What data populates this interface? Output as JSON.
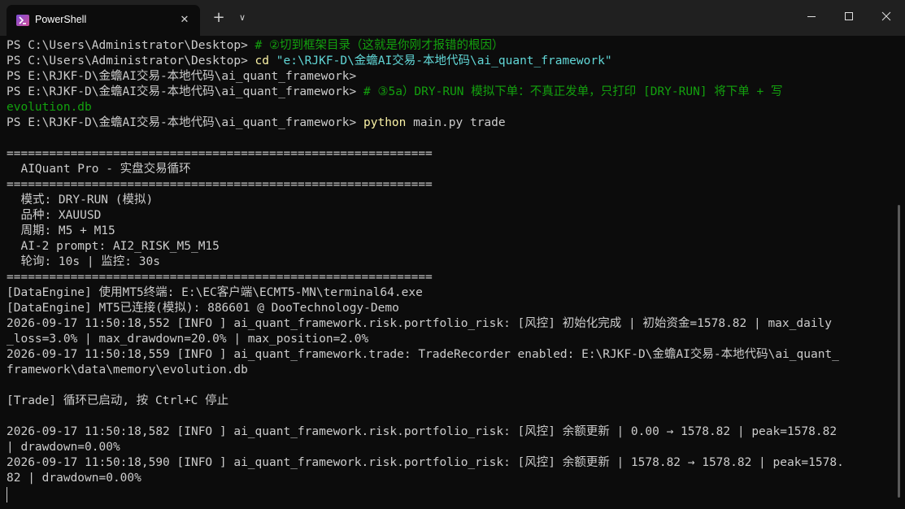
{
  "window": {
    "tab_title": "PowerShell",
    "close_tab_glyph": "✕",
    "new_tab_glyph": "+",
    "dropdown_glyph": "∨"
  },
  "terminal": {
    "l01": {
      "prompt": "PS C:\\Users\\Administrator\\Desktop> ",
      "comment": "# ②切到框架目录（这就是你刚才报错的根因）"
    },
    "l02": {
      "prompt": "PS C:\\Users\\Administrator\\Desktop> ",
      "cmd": "cd ",
      "arg": "\"e:\\RJKF-D\\金蟾AI交易-本地代码\\ai_quant_framework\""
    },
    "l03": {
      "prompt": "PS E:\\RJKF-D\\金蟾AI交易-本地代码\\ai_quant_framework>"
    },
    "l04": {
      "prompt": "PS E:\\RJKF-D\\金蟾AI交易-本地代码\\ai_quant_framework> ",
      "comment": "# ③5a）DRY-RUN 模拟下单：不真正发单，只打印 [DRY-RUN] 将下单 + 写"
    },
    "l05": {
      "comment": "evolution.db"
    },
    "l06": {
      "prompt": "PS E:\\RJKF-D\\金蟾AI交易-本地代码\\ai_quant_framework> ",
      "cmd": "python",
      "args": " main.py trade"
    },
    "l08": "============================================================",
    "l09": "  AIQuant Pro - 实盘交易循环",
    "l10": "============================================================",
    "l11": "  模式: DRY-RUN (模拟)",
    "l12": "  品种: XAUUSD",
    "l13": "  周期: M5 + M15",
    "l14": "  AI-2 prompt: AI2_RISK_M5_M15",
    "l15": "  轮询: 10s | 监控: 30s",
    "l16": "============================================================",
    "l17": "[DataEngine] 使用MT5终端: E:\\EC客户端\\ECMT5-MN\\terminal64.exe",
    "l18": "[DataEngine] MT5已连接(模拟): 886601 @ DooTechnology-Demo",
    "l19": "2026-09-17 11:50:18,552 [INFO ] ai_quant_framework.risk.portfolio_risk: [风控] 初始化完成 | 初始资金=1578.82 | max_daily",
    "l20": "_loss=3.0% | max_drawdown=20.0% | max_position=2.0%",
    "l21": "2026-09-17 11:50:18,559 [INFO ] ai_quant_framework.trade: TradeRecorder enabled: E:\\RJKF-D\\金蟾AI交易-本地代码\\ai_quant_",
    "l22": "framework\\data\\memory\\evolution.db",
    "l24": "[Trade] 循环已启动, 按 Ctrl+C 停止",
    "l26": "2026-09-17 11:50:18,582 [INFO ] ai_quant_framework.risk.portfolio_risk: [风控] 余额更新 | 0.00 → 1578.82 | peak=1578.82",
    "l27": "| drawdown=0.00%",
    "l28": "2026-09-17 11:50:18,590 [INFO ] ai_quant_framework.risk.portfolio_risk: [风控] 余额更新 | 1578.82 → 1578.82 | peak=1578.",
    "l29": "82 | drawdown=0.00%"
  }
}
